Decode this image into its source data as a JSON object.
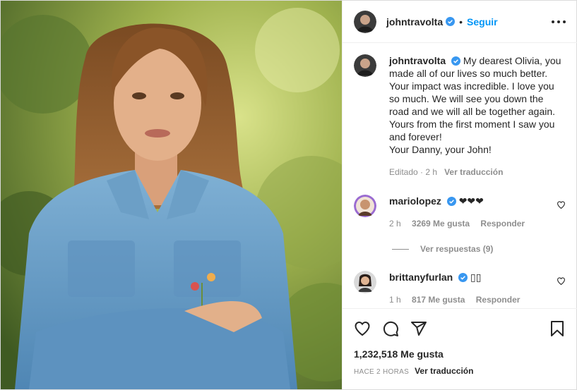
{
  "post": {
    "author": "johntravolta",
    "follow_label": "Seguir",
    "separator": "•"
  },
  "caption": {
    "username": "johntravolta",
    "text": "My dearest Olivia, you made all of our lives so much better. Your impact was incredible. I love you so much. We will see you down the road and we will all be together again. Yours from the first moment I saw you and forever!",
    "signoff": "Your Danny, your John!",
    "edited": "Editado",
    "time": "2 h",
    "translate": "Ver traducción"
  },
  "comments": [
    {
      "username": "mariolopez",
      "text": "❤❤❤",
      "time": "2 h",
      "likes": "3269 Me gusta",
      "reply": "Responder"
    },
    {
      "username": "brittanyfurlan",
      "text": "▯▯",
      "time": "1 h",
      "likes": "817 Me gusta",
      "reply": "Responder"
    }
  ],
  "view_replies": "Ver respuestas (9)",
  "footer": {
    "likes": "1,232,518 Me gusta",
    "posted": "HACE 2 HORAS",
    "translate": "Ver traducción"
  },
  "colors": {
    "accent": "#0095f6",
    "verified": "#3897f0",
    "muted": "#8e8e8e",
    "text": "#262626"
  },
  "icons": [
    "verified-badge-icon",
    "more-options-icon",
    "heart-icon",
    "comment-icon",
    "share-icon",
    "bookmark-icon"
  ]
}
